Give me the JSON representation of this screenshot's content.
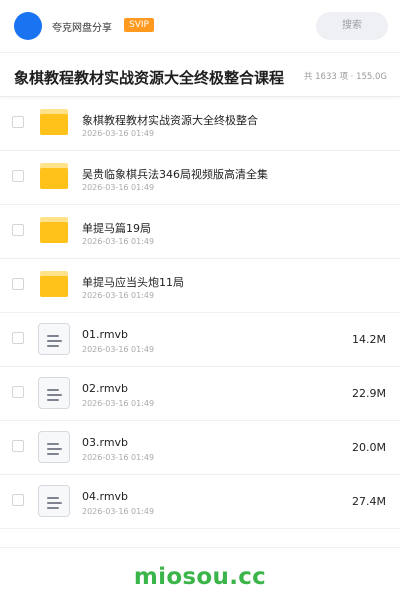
{
  "header": {
    "share_name": "夸克网盘分享",
    "badge": "SVIP",
    "search_label": "搜索"
  },
  "titlebar": {
    "title": "象棋教程教材实战资源大全终极整合课程",
    "stats": "共 1633 项 · 155.0G"
  },
  "files": [
    {
      "type": "folder",
      "icon": "folder-icon",
      "name": "象棋教程教材实战资源大全终极整合",
      "date": "2026-03-16 01:49",
      "size": ""
    },
    {
      "type": "folder",
      "icon": "folder-icon",
      "name": "吴贵临象棋兵法346局视频版高清全集",
      "date": "2026-03-16 01:49",
      "size": ""
    },
    {
      "type": "folder",
      "icon": "folder-icon",
      "name": "单提马篇19局",
      "date": "2026-03-16 01:49",
      "size": ""
    },
    {
      "type": "folder",
      "icon": "folder-icon",
      "name": "单提马应当头炮11局",
      "date": "2026-03-16 01:49",
      "size": ""
    },
    {
      "type": "file",
      "icon": "file-icon",
      "name": "01.rmvb",
      "date": "2026-03-16 01:49",
      "size": "14.2M"
    },
    {
      "type": "file",
      "icon": "file-icon",
      "name": "02.rmvb",
      "date": "2026-03-16 01:49",
      "size": "22.9M"
    },
    {
      "type": "file",
      "icon": "file-icon",
      "name": "03.rmvb",
      "date": "2026-03-16 01:49",
      "size": "20.0M"
    },
    {
      "type": "file",
      "icon": "file-icon",
      "name": "04.rmvb",
      "date": "2026-03-16 01:49",
      "size": "27.4M"
    }
  ],
  "footer": {
    "watermark": "miosou.cc"
  },
  "colors": {
    "avatar": "#1a73f0",
    "svip_badge": "#ff9a1f",
    "folder": "#ffc21a",
    "watermark": "#3bb54a"
  }
}
